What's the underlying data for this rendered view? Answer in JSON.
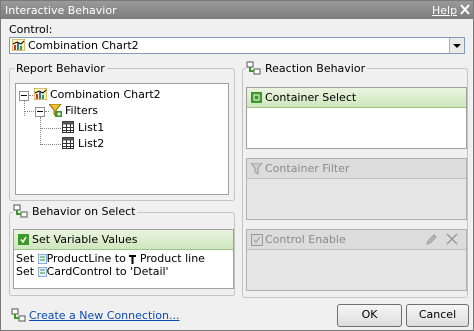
{
  "window": {
    "title": "Interactive Behavior",
    "help_label": "Help"
  },
  "control": {
    "label": "Control:",
    "selected": "Combination Chart2"
  },
  "report_behavior": {
    "legend": "Report Behavior",
    "tree": [
      {
        "label": "Combination Chart2",
        "icon": "combination-chart-icon"
      },
      {
        "label": "Filters",
        "icon": "filter-icon"
      },
      {
        "label": "List1",
        "icon": "list-icon"
      },
      {
        "label": "List2",
        "icon": "list-icon"
      }
    ]
  },
  "reaction_behavior": {
    "legend": "Reaction Behavior",
    "container_select": "Container Select",
    "container_filter": "Container Filter",
    "control_enable": "Control Enable"
  },
  "behavior_on_select": {
    "legend": "Behavior on Select",
    "header": "Set Variable Values",
    "lines": [
      {
        "prefix": "Set",
        "var": "ProductLine",
        "to": "to",
        "value": "Product line"
      },
      {
        "prefix": "Set",
        "var": "CardControl",
        "to": "to",
        "value": "'Detail'"
      }
    ]
  },
  "footer": {
    "new_connection": "Create a New Connection...",
    "ok": "OK",
    "cancel": "Cancel"
  },
  "colors": {
    "titlebar": "#8a8a8a",
    "accent_green": "#3d9a2a",
    "link": "#0b4cb5"
  }
}
